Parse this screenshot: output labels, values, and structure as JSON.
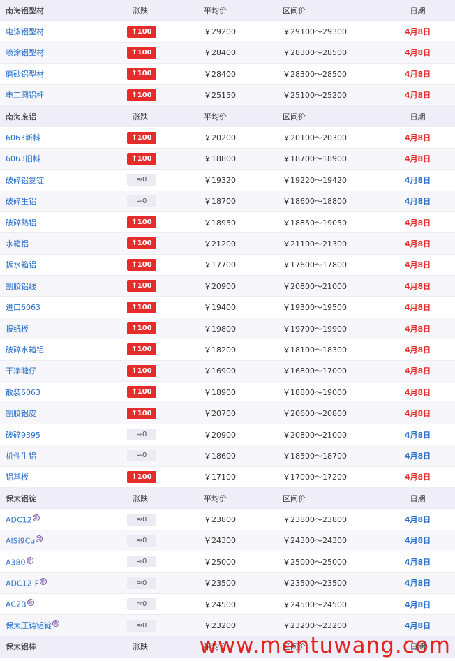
{
  "sections": [
    {
      "title": "南海铝型材",
      "headers": [
        "涨跌",
        "平均价",
        "区间价",
        "日期"
      ],
      "rows": [
        {
          "name": "电泳铝型材",
          "change": "↑100",
          "type": "up",
          "avg": "￥29200",
          "range": "￥29100～29300",
          "date": "4月8日",
          "dcolor": "red"
        },
        {
          "name": "喷涂铝型材",
          "change": "↑100",
          "type": "up",
          "avg": "￥28400",
          "range": "￥28300～28500",
          "date": "4月8日",
          "dcolor": "red"
        },
        {
          "name": "磨砂铝型材",
          "change": "↑100",
          "type": "up",
          "avg": "￥28400",
          "range": "￥28300～28500",
          "date": "4月8日",
          "dcolor": "red"
        },
        {
          "name": "电工圆铝杆",
          "change": "↑100",
          "type": "up",
          "avg": "￥25150",
          "range": "￥25100～25200",
          "date": "4月8日",
          "dcolor": "red"
        }
      ]
    },
    {
      "title": "南海废铝",
      "headers": [
        "涨跌",
        "平均价",
        "区间价",
        "日期"
      ],
      "rows": [
        {
          "name": "6063新料",
          "change": "↑100",
          "type": "up",
          "avg": "￥20200",
          "range": "￥20100～20300",
          "date": "4月8日",
          "dcolor": "red"
        },
        {
          "name": "6063旧料",
          "change": "↑100",
          "type": "up",
          "avg": "￥18800",
          "range": "￥18700～18900",
          "date": "4月8日",
          "dcolor": "red"
        },
        {
          "name": "破碎铝复锭",
          "change": "≈0",
          "type": "flat",
          "avg": "￥19320",
          "range": "￥19220～19420",
          "date": "4月8日",
          "dcolor": "blue"
        },
        {
          "name": "破碎生铝",
          "change": "≈0",
          "type": "flat",
          "avg": "￥18700",
          "range": "￥18600～18800",
          "date": "4月8日",
          "dcolor": "blue"
        },
        {
          "name": "破碎熟铝",
          "change": "↑100",
          "type": "up",
          "avg": "￥18950",
          "range": "￥18850～19050",
          "date": "4月8日",
          "dcolor": "red"
        },
        {
          "name": "水箱铝",
          "change": "↑100",
          "type": "up",
          "avg": "￥21200",
          "range": "￥21100～21300",
          "date": "4月8日",
          "dcolor": "red"
        },
        {
          "name": "拆水箱铝",
          "change": "↑100",
          "type": "up",
          "avg": "￥17700",
          "range": "￥17600～17800",
          "date": "4月8日",
          "dcolor": "red"
        },
        {
          "name": "割胶铝线",
          "change": "↑100",
          "type": "up",
          "avg": "￥20900",
          "range": "￥20800～21000",
          "date": "4月8日",
          "dcolor": "red"
        },
        {
          "name": "进口6063",
          "change": "↑100",
          "type": "up",
          "avg": "￥19400",
          "range": "￥19300～19500",
          "date": "4月8日",
          "dcolor": "red"
        },
        {
          "name": "报纸板",
          "change": "↑100",
          "type": "up",
          "avg": "￥19800",
          "range": "￥19700～19900",
          "date": "4月8日",
          "dcolor": "red"
        },
        {
          "name": "破碎水箱铝",
          "change": "↑100",
          "type": "up",
          "avg": "￥18200",
          "range": "￥18100～18300",
          "date": "4月8日",
          "dcolor": "red"
        },
        {
          "name": "干净睫仔",
          "change": "↑100",
          "type": "up",
          "avg": "￥16900",
          "range": "￥16800～17000",
          "date": "4月8日",
          "dcolor": "red"
        },
        {
          "name": "散装6063",
          "change": "↑100",
          "type": "up",
          "avg": "￥18900",
          "range": "￥18800～19000",
          "date": "4月8日",
          "dcolor": "red"
        },
        {
          "name": "割胶铝皮",
          "change": "↑100",
          "type": "up",
          "avg": "￥20700",
          "range": "￥20600～20800",
          "date": "4月8日",
          "dcolor": "red"
        },
        {
          "name": "破碎9395",
          "change": "≈0",
          "type": "flat",
          "avg": "￥20900",
          "range": "￥20800～21000",
          "date": "4月8日",
          "dcolor": "blue"
        },
        {
          "name": "机件生铝",
          "change": "≈0",
          "type": "flat",
          "avg": "￥18600",
          "range": "￥18500～18700",
          "date": "4月8日",
          "dcolor": "blue"
        },
        {
          "name": "铝基板",
          "change": "↑100",
          "type": "up",
          "avg": "￥17100",
          "range": "￥17000～17200",
          "date": "4月8日",
          "dcolor": "red"
        }
      ]
    },
    {
      "title": "保太铝锭",
      "headers": [
        "涨跌",
        "平均价",
        "区间价",
        "日期"
      ],
      "rows": [
        {
          "name": "ADC12",
          "note": "新",
          "change": "≈0",
          "type": "flat",
          "avg": "￥23800",
          "range": "￥23800～23800",
          "date": "4月8日",
          "dcolor": "blue"
        },
        {
          "name": "AlSi9Cu",
          "note": "新",
          "change": "≈0",
          "type": "flat",
          "avg": "￥24300",
          "range": "￥24300～24300",
          "date": "4月8日",
          "dcolor": "blue"
        },
        {
          "name": "A380",
          "note": "新",
          "change": "≈0",
          "type": "flat",
          "avg": "￥25000",
          "range": "￥25000～25000",
          "date": "4月8日",
          "dcolor": "blue"
        },
        {
          "name": "ADC12-F",
          "note": "新",
          "change": "≈0",
          "type": "flat",
          "avg": "￥23500",
          "range": "￥23500～23500",
          "date": "4月8日",
          "dcolor": "blue"
        },
        {
          "name": "AC2B",
          "note": "新",
          "change": "≈0",
          "type": "flat",
          "avg": "￥24500",
          "range": "￥24500～24500",
          "date": "4月8日",
          "dcolor": "blue"
        },
        {
          "name": "保太压铸铝锭",
          "note": "新",
          "change": "≈0",
          "type": "flat",
          "avg": "￥23200",
          "range": "￥23200～23200",
          "date": "4月8日",
          "dcolor": "blue"
        }
      ]
    },
    {
      "title": "保太铝棒",
      "headers": [
        "涨跌",
        "平均价",
        "区间价",
        "日期"
      ],
      "rows": []
    }
  ],
  "watermark": "www.mentuwang.com",
  "colors": {
    "up": "#e62b2b",
    "name": "#2a6fc9",
    "header_bg": "#efedf8"
  }
}
